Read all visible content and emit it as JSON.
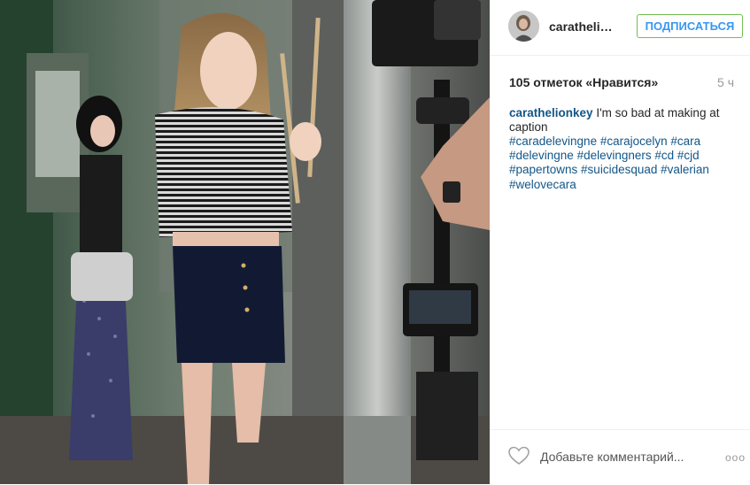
{
  "post": {
    "username": "carathelion...",
    "follow_label": "ПОДПИСАТЬСЯ",
    "likes_text": "105 отметок «Нравится»",
    "time_ago": "5 ч",
    "caption_author": "carathelionkey",
    "caption_text": "I'm so bad at making at caption",
    "hashtag_lines": [
      "#caradelevingne #carajocelyn #cara",
      "#delevingne #delevingners #cd #cjd",
      "#papertowns #suicidesquad #valerian",
      "#welovecara"
    ],
    "comment_placeholder": "Добавьте комментарий...",
    "more_label": "ooo"
  },
  "icons": {
    "heart": "heart-icon",
    "more": "more-options-icon"
  },
  "colors": {
    "accent_blue": "#3897f0",
    "link_blue": "#125688",
    "follow_border": "#70c050"
  }
}
